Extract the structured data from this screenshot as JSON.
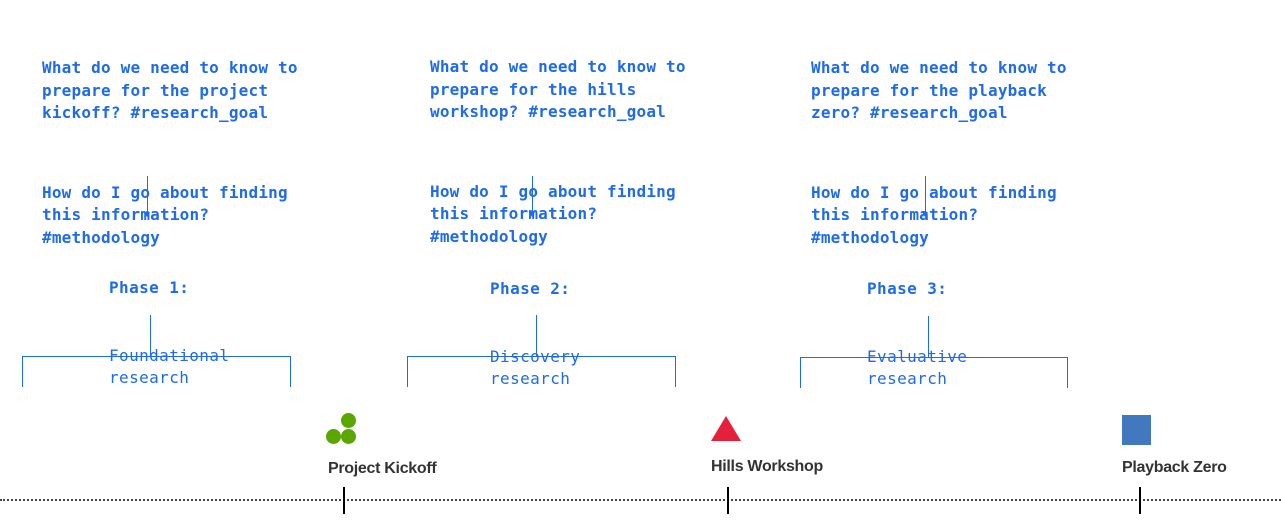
{
  "colors": {
    "primary_blue": "#1f6bec",
    "label_text": "#333333",
    "kickoff_green": "#5aa700",
    "workshop_red": "#e5203b",
    "playback_blue": "#4178be",
    "timeline": "#444444"
  },
  "columns": [
    {
      "research_goal": "What do we need to know to\nprepare for the project\nkickoff? #research_goal",
      "methodology": "How do I go about finding\nthis information?\n#methodology",
      "phase_title": "Phase 1:",
      "phase_desc": "Foundational\nresearch"
    },
    {
      "research_goal": "What do we need to know to\nprepare for the hills\nworkshop? #research_goal",
      "methodology": "How do I go about finding\nthis information?\n#methodology",
      "phase_title": "Phase 2:",
      "phase_desc": "Discovery\nresearch"
    },
    {
      "research_goal": "What do we need to know to\nprepare for the playback\nzero? #research_goal",
      "methodology": "How do I go about finding\nthis information?\n#methodology",
      "phase_title": "Phase 3:",
      "phase_desc": "Evaluative\nresearch"
    }
  ],
  "milestones": [
    {
      "label": "Project Kickoff",
      "icon": "three-dots-icon"
    },
    {
      "label": "Hills Workshop",
      "icon": "triangle-icon"
    },
    {
      "label": "Playback Zero",
      "icon": "square-icon"
    }
  ]
}
